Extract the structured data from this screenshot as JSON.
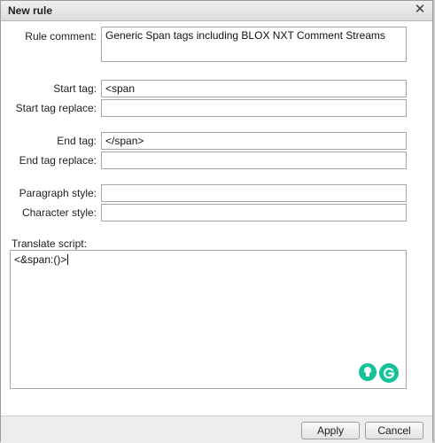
{
  "dialog": {
    "title": "New rule",
    "close_icon": "close-icon"
  },
  "form": {
    "rule_comment": {
      "label": "Rule comment:",
      "value": "Generic Span tags including BLOX NXT Comment Streams"
    },
    "start_tag": {
      "label": "Start tag:",
      "value": "<span"
    },
    "start_tag_replace": {
      "label": "Start tag replace:",
      "value": ""
    },
    "end_tag": {
      "label": "End tag:",
      "value": "</span>"
    },
    "end_tag_replace": {
      "label": "End tag replace:",
      "value": ""
    },
    "paragraph_style": {
      "label": "Paragraph style:",
      "value": ""
    },
    "character_style": {
      "label": "Character style:",
      "value": ""
    },
    "translate_script": {
      "label": "Translate script:",
      "value": "<&span:()>"
    }
  },
  "helpers": {
    "hint_icon": "lightbulb-icon",
    "grammar_icon": "grammarly-g-icon",
    "accent": "#15c39a"
  },
  "footer": {
    "apply_label": "Apply",
    "cancel_label": "Cancel"
  }
}
